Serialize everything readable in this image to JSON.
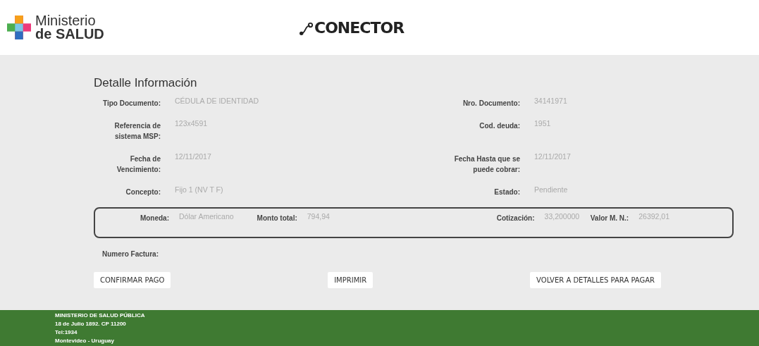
{
  "header": {
    "logo_text_1": "Ministerio",
    "logo_text_2": "de SALUD",
    "app_logo": "CONECTOR"
  },
  "detail": {
    "title": "Detalle Información",
    "rows": [
      [
        {
          "label": "Tipo Documento:",
          "value": "CÉDULA DE IDENTIDAD"
        },
        {
          "label": "Nro. Documento:",
          "value": "34141971"
        }
      ],
      [
        {
          "label": "Referencia de sistema MSP:",
          "value": "123x4591"
        },
        {
          "label": "Cod. deuda:",
          "value": "1951"
        }
      ],
      [
        {
          "label": "Fecha de Vencimiento:",
          "value": "12/11/2017"
        },
        {
          "label": "Fecha Hasta que se puede cobrar:",
          "value": "12/11/2017"
        }
      ],
      [
        {
          "label": "Concepto:",
          "value": "Fijo 1 (NV T F)"
        },
        {
          "label": "Estado:",
          "value": "Pendiente"
        }
      ]
    ],
    "amounts": [
      {
        "label": "Moneda:",
        "value": "Dólar Americano"
      },
      {
        "label": "Monto total:",
        "value": "794,94"
      },
      {
        "label": "Cotización:",
        "value": "33,200000"
      },
      {
        "label": "Valor M. N.:",
        "value": "26392,01"
      }
    ],
    "invoice_label": "Numero Factura:"
  },
  "buttons": [
    "CONFIRMAR PAGO",
    "IMPRIMIR",
    "VOLVER A DETALLES PARA PAGAR"
  ],
  "footer": [
    "MINISTERIO DE SALUD PÚBLICA",
    "18 de Julio 1892. CP 11200",
    "Tel:1934",
    "Montevideo - Uruguay"
  ]
}
